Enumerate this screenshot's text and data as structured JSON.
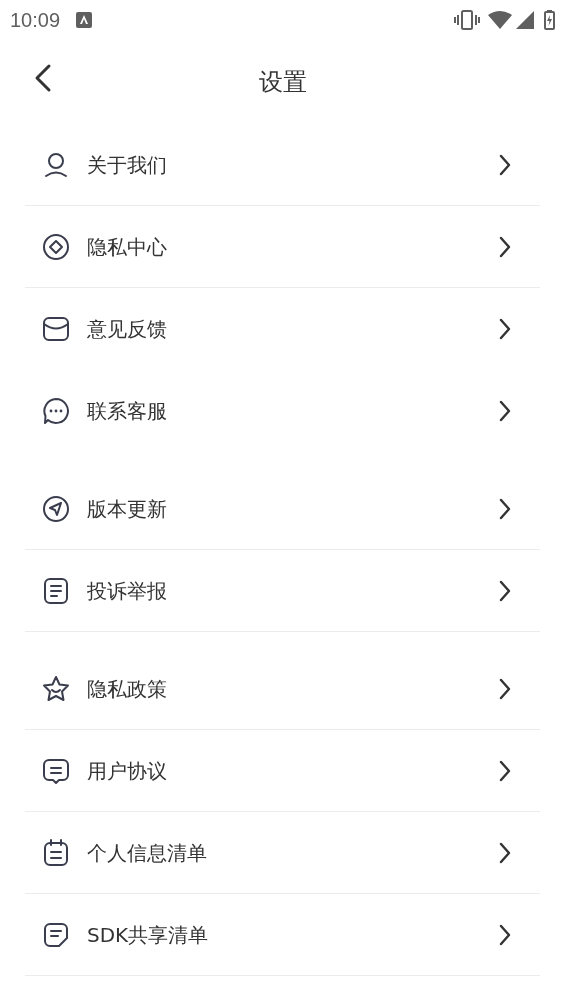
{
  "status_bar": {
    "time": "10:09"
  },
  "header": {
    "title": "设置"
  },
  "groups": [
    {
      "items": [
        {
          "label": "关于我们",
          "divider": true
        },
        {
          "label": "隐私中心",
          "divider": true
        },
        {
          "label": "意见反馈",
          "divider": false
        },
        {
          "label": "联系客服",
          "divider": false
        }
      ]
    },
    {
      "items": [
        {
          "label": "版本更新",
          "divider": true
        },
        {
          "label": "投诉举报",
          "divider": true
        }
      ]
    },
    {
      "items": [
        {
          "label": "隐私政策",
          "divider": true
        },
        {
          "label": "用户协议",
          "divider": true
        },
        {
          "label": "个人信息清单",
          "divider": true
        },
        {
          "label": "SDK共享清单",
          "divider": true
        }
      ]
    }
  ]
}
